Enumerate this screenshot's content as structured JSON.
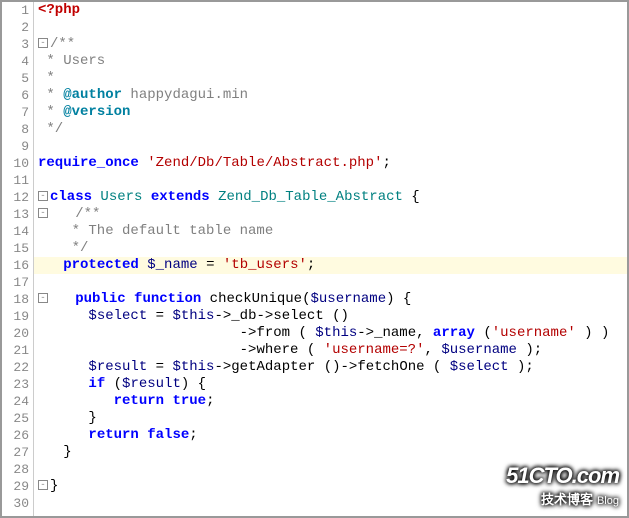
{
  "watermark": {
    "line1": "51CTO.com",
    "line2_cn": "技术博客",
    "line2_en": "Blog"
  },
  "lines": [
    {
      "n": 1,
      "fold": null,
      "hl": false,
      "tokens": [
        [
          "php",
          "<?php"
        ]
      ]
    },
    {
      "n": 2,
      "fold": null,
      "hl": false,
      "tokens": []
    },
    {
      "n": 3,
      "fold": "-",
      "hl": false,
      "tokens": [
        [
          "c",
          "/**"
        ]
      ]
    },
    {
      "n": 4,
      "fold": null,
      "hl": false,
      "tokens": [
        [
          "c",
          " * Users"
        ]
      ]
    },
    {
      "n": 5,
      "fold": null,
      "hl": false,
      "tokens": [
        [
          "c",
          " *"
        ]
      ]
    },
    {
      "n": 6,
      "fold": null,
      "hl": false,
      "tokens": [
        [
          "c",
          " * "
        ],
        [
          "tag",
          "@author"
        ],
        [
          "c",
          " happydagui.min"
        ]
      ]
    },
    {
      "n": 7,
      "fold": null,
      "hl": false,
      "tokens": [
        [
          "c",
          " * "
        ],
        [
          "tag",
          "@version"
        ]
      ]
    },
    {
      "n": 8,
      "fold": null,
      "hl": false,
      "tokens": [
        [
          "c",
          " */"
        ]
      ]
    },
    {
      "n": 9,
      "fold": null,
      "hl": false,
      "tokens": []
    },
    {
      "n": 10,
      "fold": null,
      "hl": false,
      "tokens": [
        [
          "k",
          "require_once"
        ],
        [
          "p",
          " "
        ],
        [
          "s",
          "'Zend/Db/Table/Abstract.php'"
        ],
        [
          "p",
          ";"
        ]
      ]
    },
    {
      "n": 11,
      "fold": null,
      "hl": false,
      "tokens": []
    },
    {
      "n": 12,
      "fold": "-",
      "hl": false,
      "tokens": [
        [
          "kw",
          "class"
        ],
        [
          "p",
          " "
        ],
        [
          "id",
          "Users"
        ],
        [
          "p",
          " "
        ],
        [
          "kw",
          "extends"
        ],
        [
          "p",
          " "
        ],
        [
          "id",
          "Zend_Db_Table_Abstract"
        ],
        [
          "p",
          " {"
        ]
      ]
    },
    {
      "n": 13,
      "fold": "-",
      "hl": false,
      "tokens": [
        [
          "p",
          "   "
        ],
        [
          "c",
          "/**"
        ]
      ]
    },
    {
      "n": 14,
      "fold": null,
      "hl": false,
      "tokens": [
        [
          "c",
          "    * The default table name"
        ]
      ]
    },
    {
      "n": 15,
      "fold": null,
      "hl": false,
      "tokens": [
        [
          "c",
          "    */"
        ]
      ]
    },
    {
      "n": 16,
      "fold": null,
      "hl": true,
      "tokens": [
        [
          "p",
          "   "
        ],
        [
          "kw",
          "protected"
        ],
        [
          "p",
          " "
        ],
        [
          "v",
          "$_name"
        ],
        [
          "p",
          " = "
        ],
        [
          "s",
          "'tb_users'"
        ],
        [
          "p",
          ";"
        ]
      ]
    },
    {
      "n": 17,
      "fold": null,
      "hl": false,
      "tokens": []
    },
    {
      "n": 18,
      "fold": "-",
      "hl": false,
      "tokens": [
        [
          "p",
          "   "
        ],
        [
          "kw",
          "public"
        ],
        [
          "p",
          " "
        ],
        [
          "kw",
          "function"
        ],
        [
          "p",
          " "
        ],
        [
          "fn",
          "checkUnique"
        ],
        [
          "p",
          "("
        ],
        [
          "v",
          "$username"
        ],
        [
          "p",
          ") {"
        ]
      ]
    },
    {
      "n": 19,
      "fold": null,
      "hl": false,
      "tokens": [
        [
          "p",
          "      "
        ],
        [
          "v",
          "$select"
        ],
        [
          "p",
          " = "
        ],
        [
          "v",
          "$this"
        ],
        [
          "p",
          "->"
        ],
        [
          "fn",
          "_db"
        ],
        [
          "p",
          "->"
        ],
        [
          "fn",
          "select"
        ],
        [
          "p",
          " ()"
        ]
      ]
    },
    {
      "n": 20,
      "fold": null,
      "hl": false,
      "tokens": [
        [
          "p",
          "                        ->"
        ],
        [
          "fn",
          "from"
        ],
        [
          "p",
          " ( "
        ],
        [
          "v",
          "$this"
        ],
        [
          "p",
          "->"
        ],
        [
          "fn",
          "_name"
        ],
        [
          "p",
          ", "
        ],
        [
          "kw",
          "array"
        ],
        [
          "p",
          " ("
        ],
        [
          "s",
          "'username'"
        ],
        [
          "p",
          " ) )"
        ]
      ]
    },
    {
      "n": 21,
      "fold": null,
      "hl": false,
      "tokens": [
        [
          "p",
          "                        ->"
        ],
        [
          "fn",
          "where"
        ],
        [
          "p",
          " ( "
        ],
        [
          "s",
          "'username=?'"
        ],
        [
          "p",
          ", "
        ],
        [
          "v",
          "$username"
        ],
        [
          "p",
          " );"
        ]
      ]
    },
    {
      "n": 22,
      "fold": null,
      "hl": false,
      "tokens": [
        [
          "p",
          "      "
        ],
        [
          "v",
          "$result"
        ],
        [
          "p",
          " = "
        ],
        [
          "v",
          "$this"
        ],
        [
          "p",
          "->"
        ],
        [
          "fn",
          "getAdapter"
        ],
        [
          "p",
          " ()->"
        ],
        [
          "fn",
          "fetchOne"
        ],
        [
          "p",
          " ( "
        ],
        [
          "v",
          "$select"
        ],
        [
          "p",
          " );"
        ]
      ]
    },
    {
      "n": 23,
      "fold": null,
      "hl": false,
      "tokens": [
        [
          "p",
          "      "
        ],
        [
          "kw",
          "if"
        ],
        [
          "p",
          " ("
        ],
        [
          "v",
          "$result"
        ],
        [
          "p",
          ") {"
        ]
      ]
    },
    {
      "n": 24,
      "fold": null,
      "hl": false,
      "tokens": [
        [
          "p",
          "         "
        ],
        [
          "kw",
          "return"
        ],
        [
          "p",
          " "
        ],
        [
          "kw",
          "true"
        ],
        [
          "p",
          ";"
        ]
      ]
    },
    {
      "n": 25,
      "fold": null,
      "hl": false,
      "tokens": [
        [
          "p",
          "      }"
        ]
      ]
    },
    {
      "n": 26,
      "fold": null,
      "hl": false,
      "tokens": [
        [
          "p",
          "      "
        ],
        [
          "kw",
          "return"
        ],
        [
          "p",
          " "
        ],
        [
          "kw",
          "false"
        ],
        [
          "p",
          ";"
        ]
      ]
    },
    {
      "n": 27,
      "fold": null,
      "hl": false,
      "tokens": [
        [
          "p",
          "   }"
        ]
      ]
    },
    {
      "n": 28,
      "fold": null,
      "hl": false,
      "tokens": []
    },
    {
      "n": 29,
      "fold": "-",
      "hl": false,
      "tokens": [
        [
          "p",
          "}"
        ]
      ]
    },
    {
      "n": 30,
      "fold": null,
      "hl": false,
      "tokens": []
    }
  ]
}
